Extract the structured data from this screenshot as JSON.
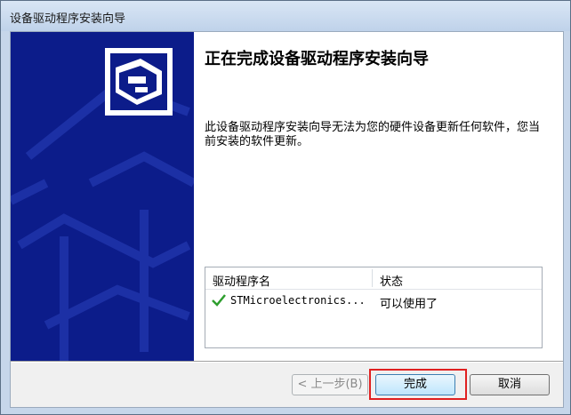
{
  "window": {
    "title": "设备驱动程序安装向导"
  },
  "main": {
    "heading": "正在完成设备驱动程序安装向导",
    "description": "此设备驱动程序安装向导无法为您的硬件设备更新任何软件，您当前安装的软件更新。"
  },
  "driver_list": {
    "columns": [
      "驱动程序名",
      "状态"
    ],
    "rows": [
      {
        "name": "STMicroelectronics...",
        "status": "可以使用了",
        "icon": "check-icon"
      }
    ]
  },
  "buttons": {
    "back": "< 上一步(B)",
    "finish": "完成",
    "cancel": "取消"
  },
  "colors": {
    "banner": "#0c1c8a",
    "check": "#2e9e2e",
    "highlight": "#e02020"
  }
}
